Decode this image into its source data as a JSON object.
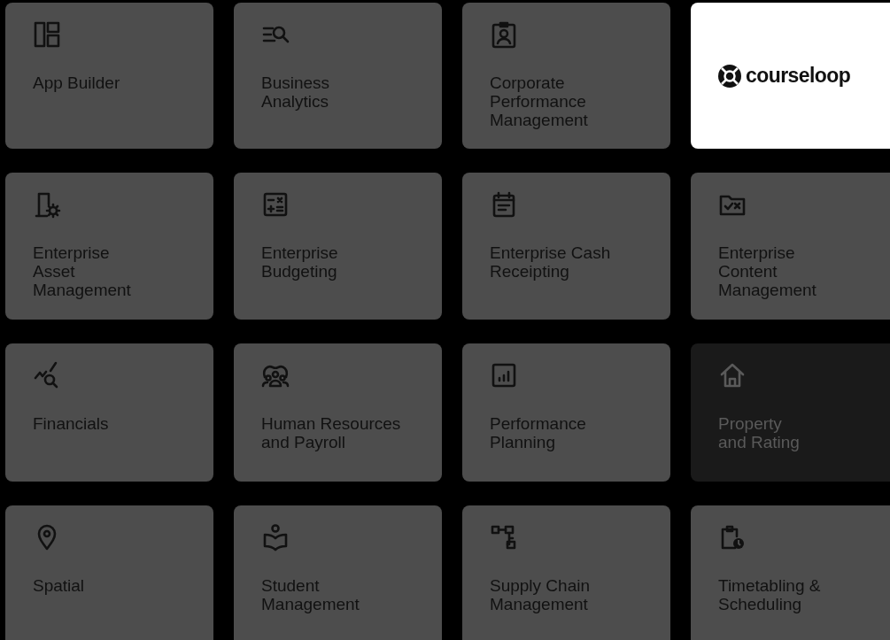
{
  "tiles": [
    {
      "kind": "app",
      "label": "App Builder",
      "disabled": false
    },
    {
      "kind": "app",
      "label": "Business\nAnalytics",
      "disabled": false
    },
    {
      "kind": "app",
      "label": "Corporate\nPerformance\nManagement",
      "disabled": false
    },
    {
      "kind": "logo",
      "label": "courseloop",
      "disabled": false
    },
    {
      "kind": "app",
      "label": "Enterprise\nAsset\nManagement",
      "disabled": false
    },
    {
      "kind": "app",
      "label": "Enterprise\nBudgeting",
      "disabled": false
    },
    {
      "kind": "app",
      "label": "Enterprise Cash\nReceipting",
      "disabled": false
    },
    {
      "kind": "app",
      "label": "Enterprise\nContent\nManagement",
      "disabled": false
    },
    {
      "kind": "app",
      "label": "Financials",
      "disabled": false
    },
    {
      "kind": "app",
      "label": "Human Resources\nand Payroll",
      "disabled": false
    },
    {
      "kind": "app",
      "label": "Performance\nPlanning",
      "disabled": false
    },
    {
      "kind": "app",
      "label": "Property\nand Rating",
      "disabled": true
    },
    {
      "kind": "app",
      "label": "Spatial",
      "disabled": false
    },
    {
      "kind": "app",
      "label": "Student\nManagement",
      "disabled": false
    },
    {
      "kind": "app",
      "label": "Supply Chain\nManagement",
      "disabled": false
    },
    {
      "kind": "app",
      "label": "Timetabling &\nScheduling",
      "disabled": false
    }
  ]
}
